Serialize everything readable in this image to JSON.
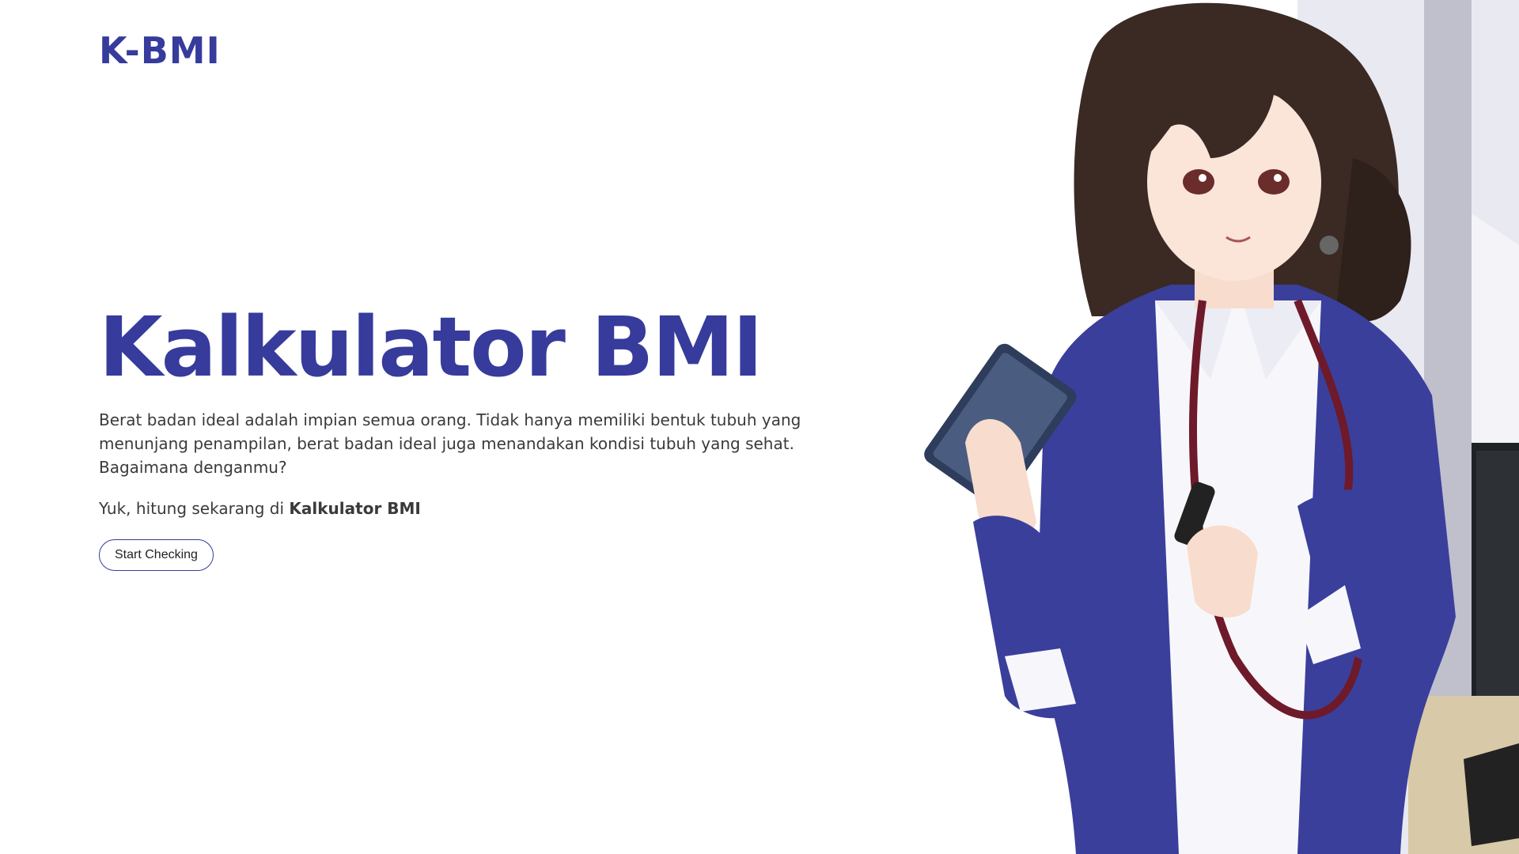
{
  "header": {
    "logo_text": "K-BMI"
  },
  "hero": {
    "title": "Kalkulator BMI",
    "description": "Berat badan ideal adalah impian semua orang. Tidak hanya memiliki bentuk tubuh yang menunjang penampilan, berat badan ideal juga menandakan kondisi tubuh yang sehat. Bagaimana denganmu?",
    "cta_prefix": "Yuk, hitung sekarang di ",
    "cta_bold": "Kalkulator BMI",
    "button_label": "Start Checking"
  },
  "colors": {
    "brand": "#363b9c",
    "body_text": "#3a3a3a",
    "background": "#ffffff",
    "jacket": "#3a3f9c"
  },
  "illustration": {
    "icon": "doctor-illustration"
  }
}
